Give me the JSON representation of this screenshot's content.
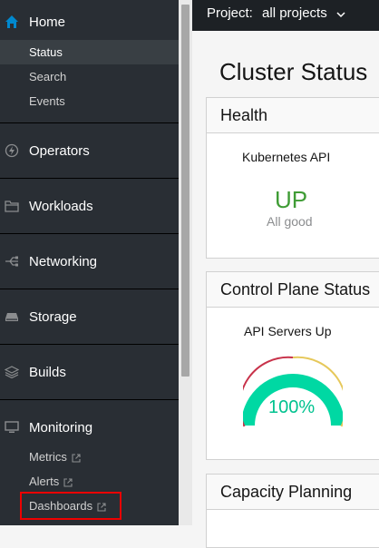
{
  "sidebar": {
    "home": {
      "label": "Home",
      "icon": "home-icon"
    },
    "home_items": [
      {
        "label": "Status",
        "active": true
      },
      {
        "label": "Search",
        "active": false
      },
      {
        "label": "Events",
        "active": false
      }
    ],
    "operators": {
      "label": "Operators",
      "icon": "bolt-icon"
    },
    "workloads": {
      "label": "Workloads",
      "icon": "folder-icon"
    },
    "networking": {
      "label": "Networking",
      "icon": "network-icon"
    },
    "storage": {
      "label": "Storage",
      "icon": "storage-icon"
    },
    "builds": {
      "label": "Builds",
      "icon": "layers-icon"
    },
    "monitoring": {
      "label": "Monitoring",
      "icon": "monitor-icon"
    },
    "monitoring_items": [
      {
        "label": "Metrics",
        "external": true
      },
      {
        "label": "Alerts",
        "external": true
      },
      {
        "label": "Dashboards",
        "external": true,
        "highlighted": true
      }
    ]
  },
  "topbar": {
    "project_label": "Project:",
    "project_value": "all projects"
  },
  "main": {
    "title": "Cluster Status",
    "health": {
      "header": "Health",
      "subtitle": "Kubernetes API",
      "status": "UP",
      "note": "All good"
    },
    "control_plane": {
      "header": "Control Plane Status",
      "subtitle": "API Servers Up",
      "gauge_value": "100%",
      "gauge_fraction": 1.0
    },
    "capacity": {
      "header": "Capacity Planning"
    }
  },
  "colors": {
    "accent": "#0088ce",
    "ok": "#3f9c35",
    "gauge": "#00d8a3",
    "highlight": "#ee0000"
  }
}
